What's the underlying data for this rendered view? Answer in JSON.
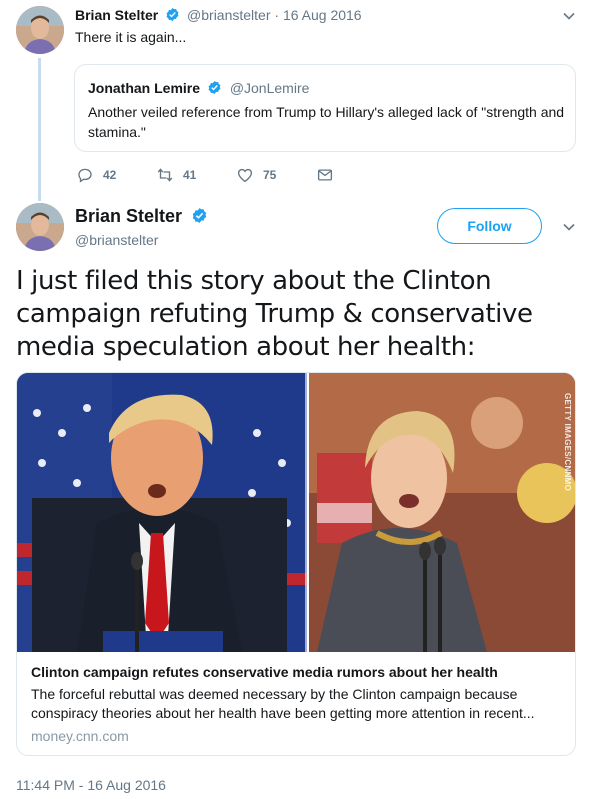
{
  "parent_tweet": {
    "name": "Brian Stelter",
    "handle": "@brianstelter",
    "date": "16 Aug 2016",
    "text": "There it is again...",
    "quoted": {
      "name": "Jonathan Lemire",
      "handle": "@JonLemire",
      "text": "Another veiled reference from Trump to Hillary's alleged lack of \"strength and stamina.\""
    },
    "actions": {
      "replies": "42",
      "retweets": "41",
      "likes": "75"
    }
  },
  "main_tweet": {
    "name": "Brian Stelter",
    "handle": "@brianstelter",
    "follow_label": "Follow",
    "text": "I just filed this story about the Clinton campaign refuting Trump & conservative media speculation about her health:",
    "card": {
      "image_credit": "GETTY IMAGES/CNNMO",
      "title": "Clinton campaign refutes conservative media rumors about her health",
      "description": "The forceful rebuttal was deemed necessary by the Clinton campaign because conspiracy theories about her health have been getting more attention in recent...",
      "domain": "money.cnn.com"
    },
    "timestamp": "11:44 PM - 16 Aug 2016"
  },
  "colors": {
    "accent": "#1da1f2",
    "secondary_text": "#657786",
    "border": "#e1e8ed",
    "thread_line": "#c7ddef"
  },
  "icons": [
    "verified-badge-icon",
    "chevron-down-icon",
    "reply-icon",
    "retweet-icon",
    "like-icon",
    "direct-message-icon"
  ]
}
